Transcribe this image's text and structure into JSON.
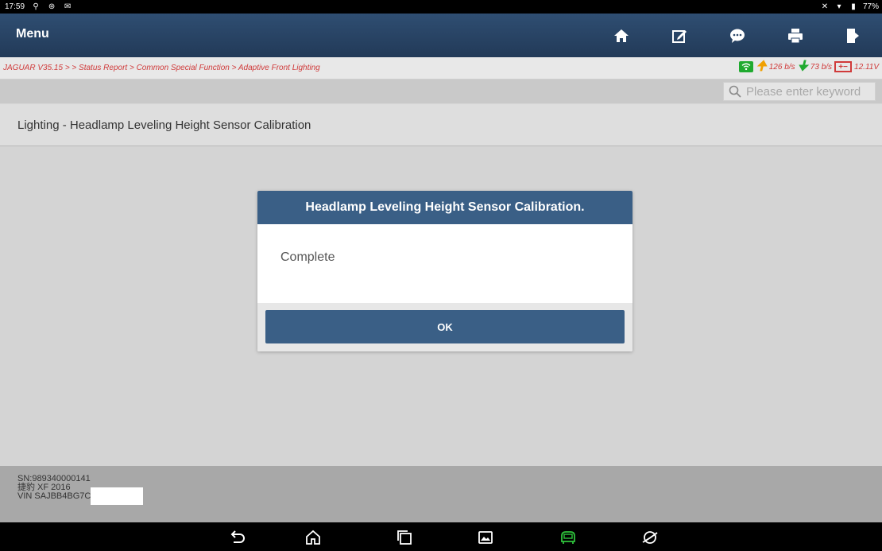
{
  "status_bar": {
    "time": "17:59",
    "battery": "77%"
  },
  "menu_bar": {
    "title": "Menu",
    "tools": [
      "home-icon",
      "edit-icon",
      "chat-icon",
      "print-icon",
      "exit-icon"
    ]
  },
  "breadcrumb": {
    "text": "JAGUAR V35.15 > > Status Report > Common Special Function > Adaptive Front Lighting",
    "upload_rate": "126 b/s",
    "download_rate": "73 b/s",
    "voltage": "12.11V"
  },
  "search": {
    "placeholder": "Please enter keyword"
  },
  "page": {
    "title": "Lighting - Headlamp Leveling Height Sensor Calibration"
  },
  "dialog": {
    "title": "Headlamp Leveling Height Sensor Calibration.",
    "message": "Complete",
    "ok_label": "OK"
  },
  "footer": {
    "sn": "SN:989340000141",
    "model": "捷豹 XF 2016",
    "vin": "VIN SAJBB4BG7C"
  },
  "colors": {
    "header_bg": "#2a4668",
    "dialog_header": "#3a5f86",
    "breadcrumb_text": "#d03a3a",
    "vci_icon": "#2fc43c"
  }
}
